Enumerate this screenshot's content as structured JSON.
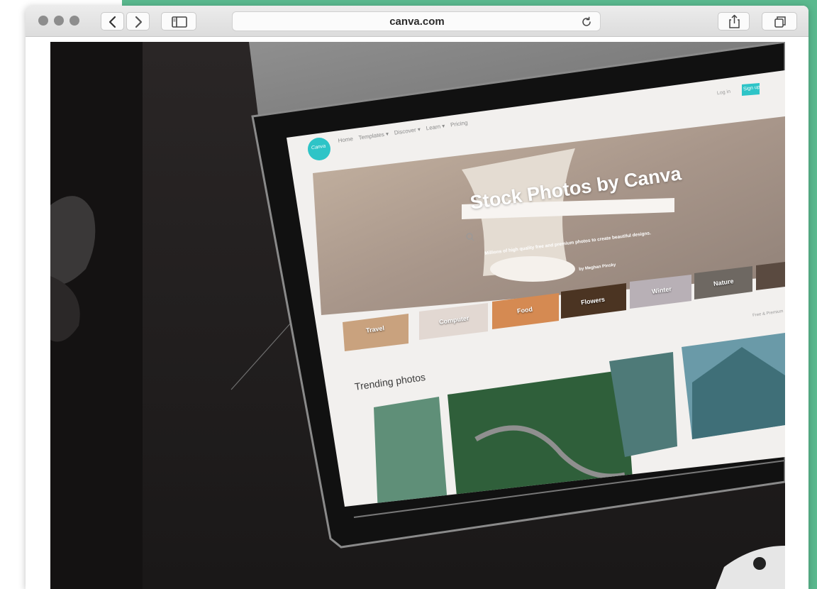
{
  "browser": {
    "url": "canva.com",
    "traffic_lights": [
      "close",
      "minimize",
      "zoom"
    ],
    "icons": {
      "back": "chevron-left-icon",
      "forward": "chevron-right-icon",
      "sidebar": "sidebar-icon",
      "reload": "reload-icon",
      "share": "share-icon",
      "tabs": "tabs-icon"
    }
  },
  "tablet_screen": {
    "logo": "Canva",
    "nav": [
      "Home",
      "Templates ▾",
      "Discover ▾",
      "Learn ▾",
      "Pricing"
    ],
    "login": "Log in",
    "signup": "Sign up",
    "hero_title": "Stock Photos by Canva",
    "hero_subtitle": "Millions of high quality free and premium photos to create beautiful designs.",
    "photo_credit": "by Meghan Pinsky",
    "categories": [
      "Travel",
      "Computer",
      "Food",
      "Flowers",
      "Winter",
      "Nature"
    ],
    "free_premium": "Free & Premium",
    "trending_title": "Trending photos"
  },
  "colors": {
    "accent": "#5ab98e",
    "canva_teal": "#2ec4c7"
  }
}
